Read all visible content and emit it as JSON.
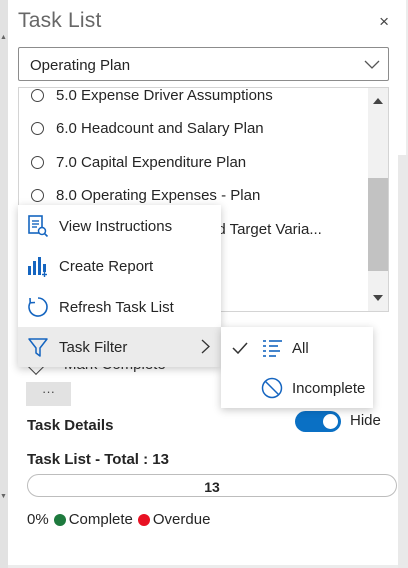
{
  "panel": {
    "title": "Task List",
    "close_glyph": "×"
  },
  "selector": {
    "value": "Operating Plan",
    "icon": "chevron-down-icon"
  },
  "task_list": {
    "items": [
      {
        "label": "5.0 Expense Driver Assumptions"
      },
      {
        "label": "6.0 Headcount and Salary Plan"
      },
      {
        "label": "7.0 Capital Expenditure Plan"
      },
      {
        "label": "8.0 Operating Expenses - Plan"
      },
      {
        "label": "nd Target Varia..."
      }
    ]
  },
  "actions_menu": {
    "items": [
      {
        "label": "View Instructions",
        "icon": "view-instructions-icon"
      },
      {
        "label": "Create Report",
        "icon": "bar-chart-icon"
      },
      {
        "label": "Refresh Task List",
        "icon": "refresh-icon"
      },
      {
        "label": "Task Filter",
        "icon": "filter-icon"
      }
    ]
  },
  "filter_submenu": {
    "items": [
      {
        "label": "All",
        "icon": "list-icon",
        "checked": true
      },
      {
        "label": "Incomplete",
        "icon": "no-entry-icon",
        "checked": false
      }
    ]
  },
  "mark_complete": {
    "label": "Mark Complete"
  },
  "more_button": {
    "label": "···"
  },
  "task_details": {
    "label": "Task Details",
    "toggle_label": "Hide",
    "toggle_on": true
  },
  "summary": {
    "label": "Task List - Total : 13",
    "progress_value": "13",
    "percent_label": "0%",
    "legend": [
      {
        "label": "Complete",
        "color": "#1e7a3e"
      },
      {
        "label": "Overdue",
        "color": "#e81123"
      }
    ]
  },
  "colors": {
    "accent": "#0a70c4",
    "complete": "#1e7a3e",
    "overdue": "#e81123"
  }
}
